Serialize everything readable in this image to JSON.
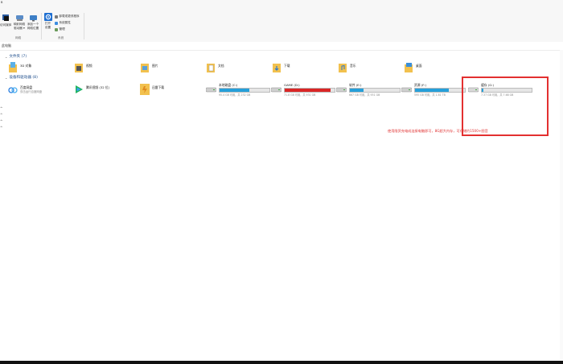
{
  "ribbon": {
    "top_label": "B",
    "network_group": {
      "buttons": [
        {
          "label": "访问媒体"
        },
        {
          "label": "映射网络\n驱动器 ▾"
        },
        {
          "label": "添加一个\n网络位置"
        }
      ],
      "group_label": "网络"
    },
    "system_group": {
      "open_settings": "打开\n设置",
      "small_items": [
        "卸载或更改程序",
        "系统属性",
        "管理"
      ],
      "group_label": "系统"
    }
  },
  "address": {
    "text": "此电脑"
  },
  "nav_marks": [
    "^",
    "^",
    "^",
    "^"
  ],
  "folders_section": {
    "title": "文件夹 (7)",
    "items": [
      {
        "label": "3D 对象",
        "icon": "3d-objects-icon"
      },
      {
        "label": "视频",
        "icon": "video-folder-icon"
      },
      {
        "label": "图片",
        "icon": "pictures-folder-icon"
      },
      {
        "label": "文档",
        "icon": "documents-folder-icon"
      },
      {
        "label": "下载",
        "icon": "downloads-folder-icon"
      },
      {
        "label": "音乐",
        "icon": "music-folder-icon"
      },
      {
        "label": "桌面",
        "icon": "desktop-folder-icon"
      }
    ]
  },
  "devices_section": {
    "title": "设备和驱动器 (8)",
    "items": [
      {
        "label": "百度网盘",
        "sub": "双击运行百度网盘",
        "icon": "baidu-netdisk-icon"
      },
      {
        "label": "腾讯视频 (32 位)",
        "icon": "tencent-video-icon"
      },
      {
        "label": "迅雷下载",
        "icon": "thunder-download-icon"
      }
    ],
    "drives": [
      {
        "label": "本地磁盘 (C:)",
        "sub": "95.4 GB 可用，共 232 GB",
        "used": 0.59,
        "color": "#26a0da"
      },
      {
        "label": "GAME (D:)",
        "sub": "71.8 GB 可用，共 931 GB",
        "used": 0.92,
        "color": "#da2626"
      },
      {
        "label": "软件 (E:)",
        "sub": "667 GB 可用，共 931 GB",
        "used": 0.28,
        "color": "#26a0da"
      },
      {
        "label": "资源 (F:)",
        "sub": "595 GB 可用，共 1.81 TB",
        "used": 0.68,
        "color": "#26a0da"
      },
      {
        "label": "缓存 (G:)",
        "sub": "7.37 GB 可用，共 7.68 GB",
        "used": 0.04,
        "color": "#26a0da"
      }
    ]
  },
  "annotation": {
    "text": "使用限资充电成连接电脑即可，8G超大内存，可存储约1500+图音",
    "color": "#e03232"
  }
}
